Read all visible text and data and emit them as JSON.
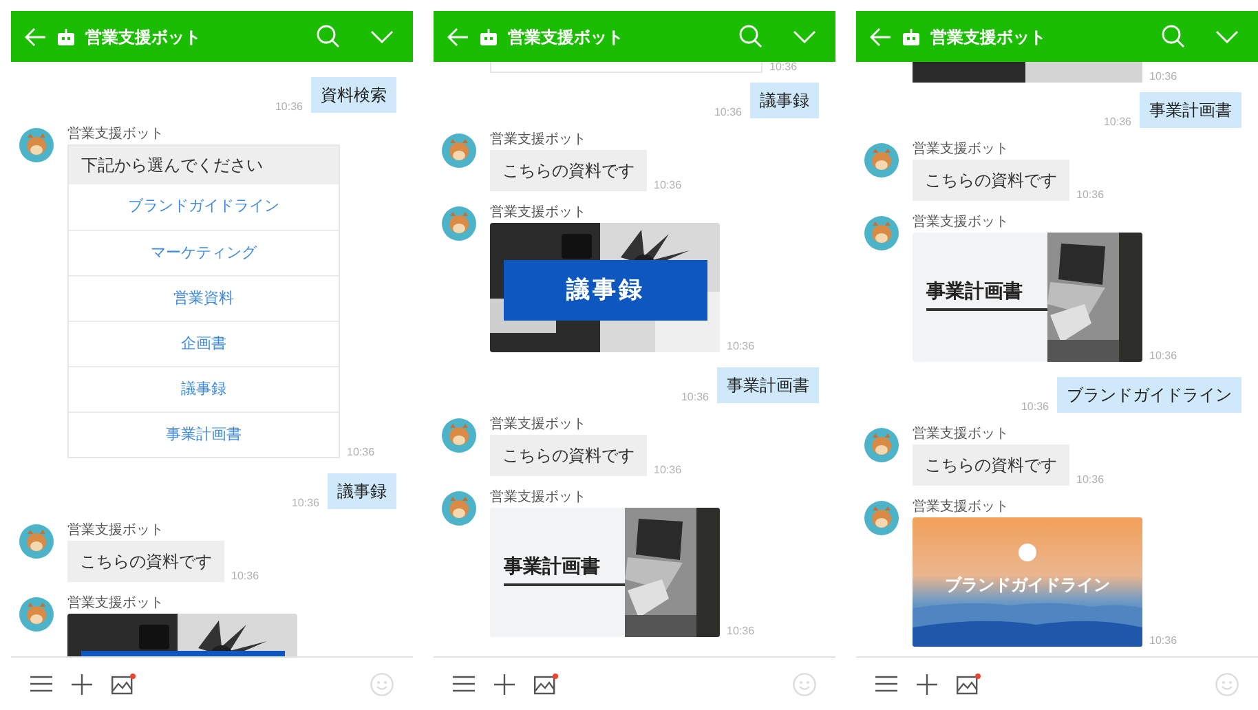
{
  "screens": [
    {
      "header": {
        "title": "営業支援ボット"
      },
      "messages": [
        {
          "kind": "user",
          "text": "資料検索",
          "time": "10:36"
        },
        {
          "kind": "bot_menu",
          "sender": "営業支援ボット",
          "prompt": "下記から選んでください",
          "options": [
            "ブランドガイドライン",
            "マーケティング",
            "営業資料",
            "企画書",
            "議事録",
            "事業計画書"
          ],
          "time": "10:36"
        },
        {
          "kind": "user",
          "text": "議事録",
          "time": "10:36"
        },
        {
          "kind": "bot_text",
          "sender": "営業支援ボット",
          "text": "こちらの資料です",
          "time": "10:36"
        },
        {
          "kind": "bot_image",
          "sender": "営業支援ボット",
          "image": {
            "kind": "blue_banner"
          }
        }
      ]
    },
    {
      "header": {
        "title": "営業支援ボット"
      },
      "messages": [
        {
          "kind": "menu_end",
          "time": "10:36"
        },
        {
          "kind": "user",
          "text": "議事録",
          "time": "10:36"
        },
        {
          "kind": "bot_text",
          "sender": "営業支援ボット",
          "text": "こちらの資料です",
          "time": "10:36"
        },
        {
          "kind": "bot_image",
          "sender": "営業支援ボット",
          "image": {
            "kind": "blue_banner",
            "title": "議事録"
          },
          "time": "10:36"
        },
        {
          "kind": "user",
          "text": "事業計画書",
          "time": "10:36"
        },
        {
          "kind": "bot_text",
          "sender": "営業支援ボット",
          "text": "こちらの資料です",
          "time": "10:36"
        },
        {
          "kind": "bot_image",
          "sender": "営業支援ボット",
          "image": {
            "kind": "line_title",
            "title": "事業計画書"
          },
          "time": "10:36"
        }
      ]
    },
    {
      "header": {
        "title": "営業支援ボット"
      },
      "messages": [
        {
          "kind": "image_end",
          "time": "10:36"
        },
        {
          "kind": "user",
          "text": "事業計画書",
          "time": "10:36"
        },
        {
          "kind": "bot_text",
          "sender": "営業支援ボット",
          "text": "こちらの資料です",
          "time": "10:36"
        },
        {
          "kind": "bot_image",
          "sender": "営業支援ボット",
          "image": {
            "kind": "line_title",
            "title": "事業計画書"
          },
          "time": "10:36"
        },
        {
          "kind": "user",
          "text": "ブランドガイドライン",
          "time": "10:36"
        },
        {
          "kind": "bot_text",
          "sender": "営業支援ボット",
          "text": "こちらの資料です",
          "time": "10:36"
        },
        {
          "kind": "bot_image",
          "sender": "営業支援ボット",
          "image": {
            "kind": "gradient",
            "title": "ブランドガイドライン"
          },
          "time": "10:36"
        }
      ]
    }
  ]
}
